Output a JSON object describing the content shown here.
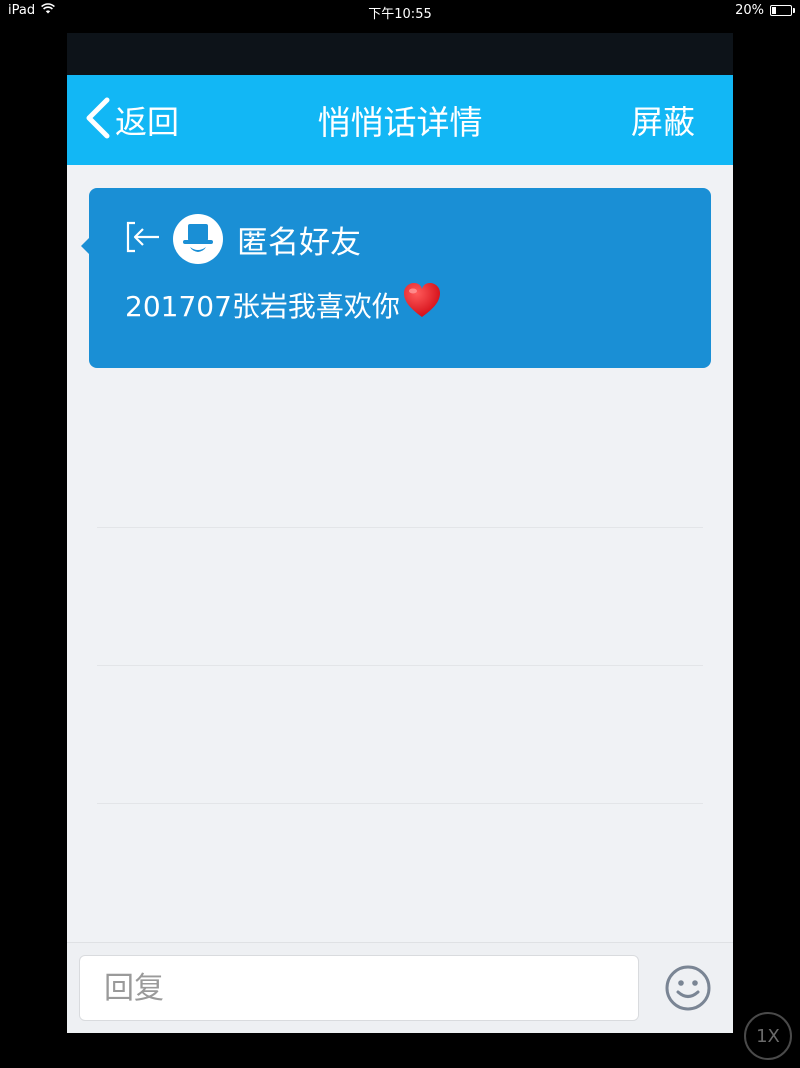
{
  "status_bar": {
    "device": "iPad",
    "time": "下午10:55",
    "battery_text": "20%",
    "battery_level": 0.2
  },
  "navbar": {
    "back_label": "返回",
    "title": "悄悄话详情",
    "right_label": "屏蔽",
    "background": "#12b7f5"
  },
  "message": {
    "sender": "匿名好友",
    "text": "201707张岩我喜欢你",
    "emoji": "❤️",
    "bubble_color": "#1a8fd5",
    "icons": [
      "incoming-arrow-icon",
      "anonymous-avatar-icon"
    ]
  },
  "reply": {
    "placeholder": "回复",
    "emoji_icon": "smiley-icon"
  },
  "zoom": {
    "label": "1X"
  }
}
